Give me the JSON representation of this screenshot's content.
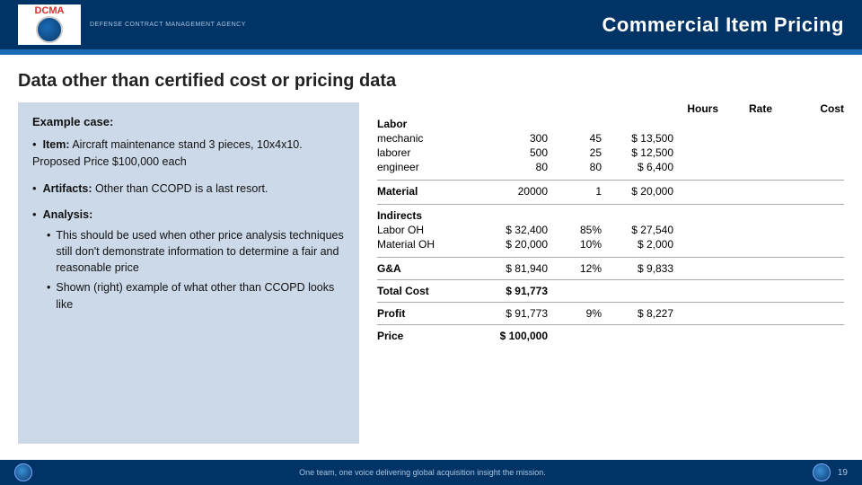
{
  "header": {
    "title": "Commercial Item Pricing",
    "agency_name": "DEFENSE CONTRACT MANAGEMENT AGENCY",
    "logo_letters": "DCMA"
  },
  "page": {
    "title": "Data other than certified cost or pricing data"
  },
  "left_panel": {
    "example_label": "Example case:",
    "bullets": [
      {
        "title": "Item:",
        "text": " Aircraft maintenance stand 3 pieces, 10x4x10. Proposed Price $100,000 each"
      },
      {
        "title": "Artifacts:",
        "text": " Other than CCOPD is a last resort."
      }
    ],
    "analysis": {
      "title": "Analysis:",
      "sub_bullets": [
        "This should be used when other price analysis techniques still don't demonstrate information to determine a fair and reasonable price",
        "Shown (right) example of what other than CCOPD looks like"
      ]
    }
  },
  "table": {
    "headers": {
      "hours": "Hours",
      "rate": "Rate",
      "cost": "Cost"
    },
    "labor": {
      "label": "Labor",
      "rows": [
        {
          "name": "mechanic",
          "hours": "300",
          "rate": "45",
          "cost": "$ 13,500"
        },
        {
          "name": "laborer",
          "hours": "500",
          "rate": "25",
          "cost": "$ 12,500"
        },
        {
          "name": "engineer",
          "hours": "80",
          "rate": "80",
          "cost": "$   6,400"
        }
      ]
    },
    "material": {
      "label": "Material",
      "hours": "20000",
      "rate": "1",
      "cost": "$ 20,000"
    },
    "indirects": {
      "label": "Indirects",
      "rows": [
        {
          "name": "Labor OH",
          "value": "$ 32,400",
          "rate": "85%",
          "cost": "$ 27,540"
        },
        {
          "name": "Material OH",
          "value": "$ 20,000",
          "rate": "10%",
          "cost": "$   2,000"
        }
      ]
    },
    "ga": {
      "label": "G&A",
      "value": "$ 81,940",
      "rate": "12%",
      "cost": "$   9,833"
    },
    "total_cost": {
      "label": "Total Cost",
      "value": "$ 91,773"
    },
    "profit": {
      "label": "Profit",
      "value": "$ 91,773",
      "rate": "9%",
      "cost": "$   8,227"
    },
    "price": {
      "label": "Price",
      "value": "$ 100,000"
    }
  },
  "footer": {
    "text": "One team, one voice delivering global acquisition insight the mission.",
    "page": "19"
  }
}
